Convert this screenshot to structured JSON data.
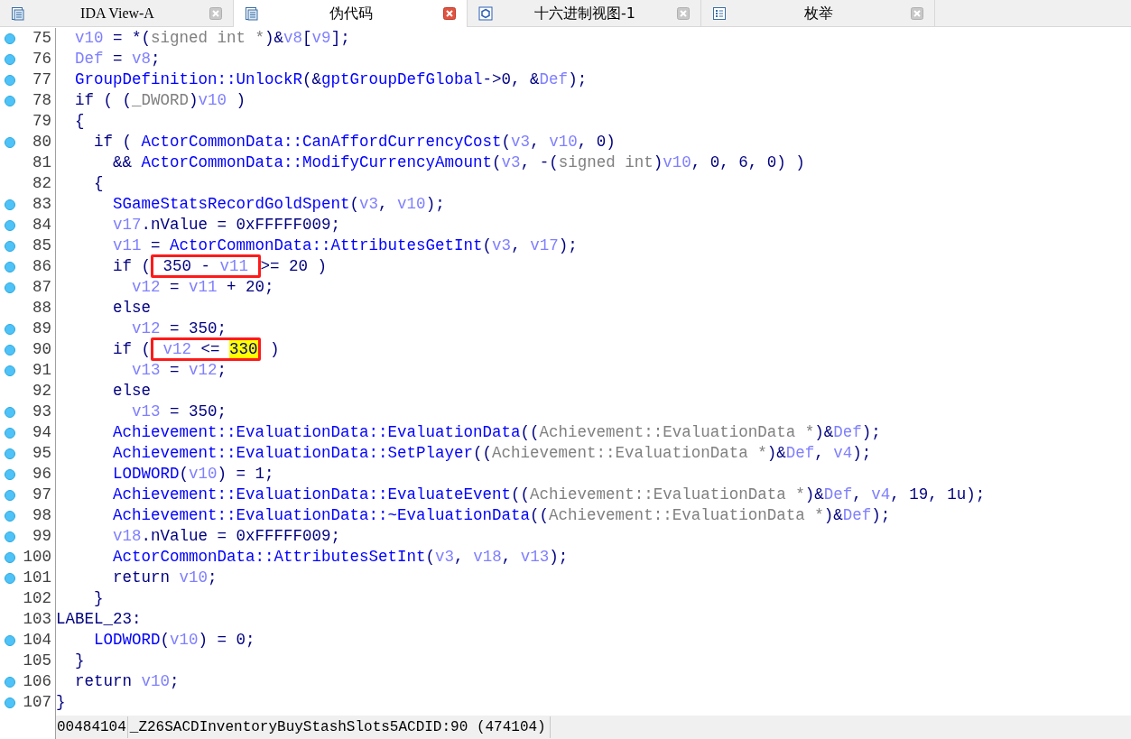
{
  "tabs": [
    {
      "label": "IDA View-A",
      "kind": "listing",
      "selected": false
    },
    {
      "label": "伪代码",
      "kind": "listing",
      "selected": true
    },
    {
      "label": "十六进制视图-1",
      "kind": "hex",
      "selected": false
    },
    {
      "label": "枚举",
      "kind": "enum",
      "selected": false
    }
  ],
  "code": {
    "lines": [
      {
        "number": "75",
        "breakpoint": true,
        "tokens": [
          {
            "kind": "var",
            "text": "  v10"
          },
          {
            "kind": "plain",
            "text": " = *("
          },
          {
            "kind": "cast",
            "text": "signed int *"
          },
          {
            "kind": "plain",
            "text": ")&"
          },
          {
            "kind": "var",
            "text": "v8"
          },
          {
            "kind": "plain",
            "text": "["
          },
          {
            "kind": "var",
            "text": "v9"
          },
          {
            "kind": "plain",
            "text": "];"
          }
        ]
      },
      {
        "number": "76",
        "breakpoint": true,
        "tokens": [
          {
            "kind": "var",
            "text": "  Def"
          },
          {
            "kind": "plain",
            "text": " = "
          },
          {
            "kind": "var",
            "text": "v8"
          },
          {
            "kind": "plain",
            "text": ";"
          }
        ]
      },
      {
        "number": "77",
        "breakpoint": true,
        "tokens": [
          {
            "kind": "func",
            "text": "  GroupDefinition::UnlockR"
          },
          {
            "kind": "plain",
            "text": "(&"
          },
          {
            "kind": "func",
            "text": "gptGroupDefGlobal"
          },
          {
            "kind": "plain",
            "text": "->0, &"
          },
          {
            "kind": "var",
            "text": "Def"
          },
          {
            "kind": "plain",
            "text": ");"
          }
        ]
      },
      {
        "number": "78",
        "breakpoint": true,
        "tokens": [
          {
            "kind": "plain",
            "text": "  if ( ("
          },
          {
            "kind": "cast",
            "text": "_DWORD"
          },
          {
            "kind": "plain",
            "text": ")"
          },
          {
            "kind": "var",
            "text": "v10"
          },
          {
            "kind": "plain",
            "text": " )"
          }
        ]
      },
      {
        "number": "79",
        "breakpoint": false,
        "tokens": [
          {
            "kind": "plain",
            "text": "  {"
          }
        ]
      },
      {
        "number": "80",
        "breakpoint": true,
        "tokens": [
          {
            "kind": "plain",
            "text": "    if ( "
          },
          {
            "kind": "func",
            "text": "ActorCommonData::CanAffordCurrencyCost"
          },
          {
            "kind": "plain",
            "text": "("
          },
          {
            "kind": "var",
            "text": "v3"
          },
          {
            "kind": "plain",
            "text": ", "
          },
          {
            "kind": "var",
            "text": "v10"
          },
          {
            "kind": "plain",
            "text": ", 0)"
          }
        ]
      },
      {
        "number": "81",
        "breakpoint": false,
        "tokens": [
          {
            "kind": "plain",
            "text": "      && "
          },
          {
            "kind": "func",
            "text": "ActorCommonData::ModifyCurrencyAmount"
          },
          {
            "kind": "plain",
            "text": "("
          },
          {
            "kind": "var",
            "text": "v3"
          },
          {
            "kind": "plain",
            "text": ", -("
          },
          {
            "kind": "cast",
            "text": "signed int"
          },
          {
            "kind": "plain",
            "text": ")"
          },
          {
            "kind": "var",
            "text": "v10"
          },
          {
            "kind": "plain",
            "text": ", 0, 6, 0) )"
          }
        ]
      },
      {
        "number": "82",
        "breakpoint": false,
        "tokens": [
          {
            "kind": "plain",
            "text": "    {"
          }
        ]
      },
      {
        "number": "83",
        "breakpoint": true,
        "tokens": [
          {
            "kind": "func",
            "text": "      SGameStatsRecordGoldSpent"
          },
          {
            "kind": "plain",
            "text": "("
          },
          {
            "kind": "var",
            "text": "v3"
          },
          {
            "kind": "plain",
            "text": ", "
          },
          {
            "kind": "var",
            "text": "v10"
          },
          {
            "kind": "plain",
            "text": ");"
          }
        ]
      },
      {
        "number": "84",
        "breakpoint": true,
        "tokens": [
          {
            "kind": "var",
            "text": "      v17"
          },
          {
            "kind": "plain",
            "text": ".nValue = 0xFFFFF009;"
          }
        ]
      },
      {
        "number": "85",
        "breakpoint": true,
        "tokens": [
          {
            "kind": "var",
            "text": "      v11"
          },
          {
            "kind": "plain",
            "text": " = "
          },
          {
            "kind": "func",
            "text": "ActorCommonData::AttributesGetInt"
          },
          {
            "kind": "plain",
            "text": "("
          },
          {
            "kind": "var",
            "text": "v3"
          },
          {
            "kind": "plain",
            "text": ", "
          },
          {
            "kind": "var",
            "text": "v17"
          },
          {
            "kind": "plain",
            "text": ");"
          }
        ]
      },
      {
        "number": "86",
        "breakpoint": true,
        "tokens": [
          {
            "kind": "plain",
            "text": "      if ("
          },
          {
            "kind": "frame",
            "parts": [
              {
                "kind": "plain",
                "text": " 350 - "
              },
              {
                "kind": "var",
                "text": "v11 "
              }
            ]
          },
          {
            "kind": "plain",
            "text": ">= 20 )"
          }
        ]
      },
      {
        "number": "87",
        "breakpoint": true,
        "tokens": [
          {
            "kind": "var",
            "text": "        v12"
          },
          {
            "kind": "plain",
            "text": " = "
          },
          {
            "kind": "var",
            "text": "v11"
          },
          {
            "kind": "plain",
            "text": " + 20;"
          }
        ]
      },
      {
        "number": "88",
        "breakpoint": false,
        "tokens": [
          {
            "kind": "plain",
            "text": "      else"
          }
        ]
      },
      {
        "number": "89",
        "breakpoint": true,
        "tokens": [
          {
            "kind": "var",
            "text": "        v12"
          },
          {
            "kind": "plain",
            "text": " = 350;"
          }
        ]
      },
      {
        "number": "90",
        "breakpoint": true,
        "tokens": [
          {
            "kind": "plain",
            "text": "      if ("
          },
          {
            "kind": "frame",
            "parts": [
              {
                "kind": "var",
                "text": " v12"
              },
              {
                "kind": "plain",
                "text": " <= "
              },
              {
                "kind": "hit",
                "text": "330"
              }
            ]
          },
          {
            "kind": "plain",
            "text": " )"
          }
        ]
      },
      {
        "number": "91",
        "breakpoint": true,
        "tokens": [
          {
            "kind": "var",
            "text": "        v13"
          },
          {
            "kind": "plain",
            "text": " = "
          },
          {
            "kind": "var",
            "text": "v12"
          },
          {
            "kind": "plain",
            "text": ";"
          }
        ]
      },
      {
        "number": "92",
        "breakpoint": false,
        "tokens": [
          {
            "kind": "plain",
            "text": "      else"
          }
        ]
      },
      {
        "number": "93",
        "breakpoint": true,
        "tokens": [
          {
            "kind": "var",
            "text": "        v13"
          },
          {
            "kind": "plain",
            "text": " = 350;"
          }
        ]
      },
      {
        "number": "94",
        "breakpoint": true,
        "tokens": [
          {
            "kind": "func",
            "text": "      Achievement::EvaluationData::EvaluationData"
          },
          {
            "kind": "plain",
            "text": "(("
          },
          {
            "kind": "cast",
            "text": "Achievement::EvaluationData *"
          },
          {
            "kind": "plain",
            "text": ")&"
          },
          {
            "kind": "var",
            "text": "Def"
          },
          {
            "kind": "plain",
            "text": ");"
          }
        ]
      },
      {
        "number": "95",
        "breakpoint": true,
        "tokens": [
          {
            "kind": "func",
            "text": "      Achievement::EvaluationData::SetPlayer"
          },
          {
            "kind": "plain",
            "text": "(("
          },
          {
            "kind": "cast",
            "text": "Achievement::EvaluationData *"
          },
          {
            "kind": "plain",
            "text": ")&"
          },
          {
            "kind": "var",
            "text": "Def"
          },
          {
            "kind": "plain",
            "text": ", "
          },
          {
            "kind": "var",
            "text": "v4"
          },
          {
            "kind": "plain",
            "text": ");"
          }
        ]
      },
      {
        "number": "96",
        "breakpoint": true,
        "tokens": [
          {
            "kind": "func",
            "text": "      LODWORD"
          },
          {
            "kind": "plain",
            "text": "("
          },
          {
            "kind": "var",
            "text": "v10"
          },
          {
            "kind": "plain",
            "text": ") = 1;"
          }
        ]
      },
      {
        "number": "97",
        "breakpoint": true,
        "tokens": [
          {
            "kind": "func",
            "text": "      Achievement::EvaluationData::EvaluateEvent"
          },
          {
            "kind": "plain",
            "text": "(("
          },
          {
            "kind": "cast",
            "text": "Achievement::EvaluationData *"
          },
          {
            "kind": "plain",
            "text": ")&"
          },
          {
            "kind": "var",
            "text": "Def"
          },
          {
            "kind": "plain",
            "text": ", "
          },
          {
            "kind": "var",
            "text": "v4"
          },
          {
            "kind": "plain",
            "text": ", 19, 1u);"
          }
        ]
      },
      {
        "number": "98",
        "breakpoint": true,
        "tokens": [
          {
            "kind": "func",
            "text": "      Achievement::EvaluationData::~EvaluationData"
          },
          {
            "kind": "plain",
            "text": "(("
          },
          {
            "kind": "cast",
            "text": "Achievement::EvaluationData *"
          },
          {
            "kind": "plain",
            "text": ")&"
          },
          {
            "kind": "var",
            "text": "Def"
          },
          {
            "kind": "plain",
            "text": ");"
          }
        ]
      },
      {
        "number": "99",
        "breakpoint": true,
        "tokens": [
          {
            "kind": "var",
            "text": "      v18"
          },
          {
            "kind": "plain",
            "text": ".nValue = 0xFFFFF009;"
          }
        ]
      },
      {
        "number": "100",
        "breakpoint": true,
        "tokens": [
          {
            "kind": "func",
            "text": "      ActorCommonData::AttributesSetInt"
          },
          {
            "kind": "plain",
            "text": "("
          },
          {
            "kind": "var",
            "text": "v3"
          },
          {
            "kind": "plain",
            "text": ", "
          },
          {
            "kind": "var",
            "text": "v18"
          },
          {
            "kind": "plain",
            "text": ", "
          },
          {
            "kind": "var",
            "text": "v13"
          },
          {
            "kind": "plain",
            "text": ");"
          }
        ]
      },
      {
        "number": "101",
        "breakpoint": true,
        "tokens": [
          {
            "kind": "plain",
            "text": "      return "
          },
          {
            "kind": "var",
            "text": "v10"
          },
          {
            "kind": "plain",
            "text": ";"
          }
        ]
      },
      {
        "number": "102",
        "breakpoint": false,
        "tokens": [
          {
            "kind": "plain",
            "text": "    }"
          }
        ]
      },
      {
        "number": "103",
        "breakpoint": false,
        "tokens": [
          {
            "kind": "plain",
            "text": "LABEL_23:"
          }
        ]
      },
      {
        "number": "104",
        "breakpoint": true,
        "tokens": [
          {
            "kind": "func",
            "text": "    LODWORD"
          },
          {
            "kind": "plain",
            "text": "("
          },
          {
            "kind": "var",
            "text": "v10"
          },
          {
            "kind": "plain",
            "text": ") = 0;"
          }
        ]
      },
      {
        "number": "105",
        "breakpoint": false,
        "tokens": [
          {
            "kind": "plain",
            "text": "  }"
          }
        ]
      },
      {
        "number": "106",
        "breakpoint": true,
        "tokens": [
          {
            "kind": "plain",
            "text": "  return "
          },
          {
            "kind": "var",
            "text": "v10"
          },
          {
            "kind": "plain",
            "text": ";"
          }
        ]
      },
      {
        "number": "107",
        "breakpoint": true,
        "tokens": [
          {
            "kind": "plain",
            "text": "}"
          }
        ]
      }
    ]
  },
  "status_bar": {
    "address": "00484104",
    "location": "_Z26SACDInventoryBuyStashSlots5ACDID:90 (474104)"
  }
}
